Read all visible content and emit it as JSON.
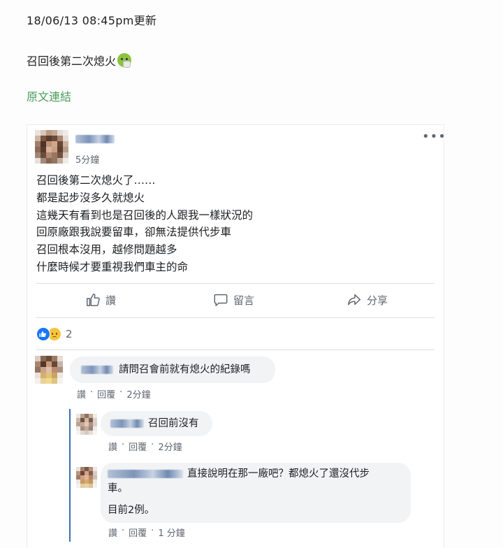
{
  "update_line": "18/06/13 08:45pm更新",
  "headline": "召回後第二次熄火",
  "headline_emoji": "sick-face-emoji",
  "source_link": "原文連結",
  "post": {
    "time": "5分鐘",
    "more": "•••",
    "body": [
      "召回後第二次熄火了……",
      "都是起步沒多久就熄火",
      "這幾天有看到也是召回後的人跟我一樣狀況的",
      "回原廠跟我說要留車，卻無法提供代步車",
      "召回根本沒用，越修問題越多",
      "什麼時候才要重視我們車主的命"
    ],
    "actions": {
      "like": "讚",
      "comment": "留言",
      "share": "分享"
    },
    "reaction_count": "2",
    "accent_color": "#1877f2"
  },
  "comments": [
    {
      "text": "請問召會前就有熄火的紀錄嗎",
      "like": "讚",
      "reply": "回覆",
      "dot": "·",
      "time": "2分鐘"
    },
    {
      "text": "召回前沒有",
      "like": "讚",
      "reply": "回覆",
      "dot": "·",
      "time": "2分鐘"
    },
    {
      "text_line1": "直接說明在那一廠吧？都熄火了還沒代步",
      "text_line2": "車。",
      "text_line3": "目前2例。",
      "like": "讚",
      "reply": "回覆",
      "dot": "·",
      "time": "1 分鐘"
    }
  ]
}
